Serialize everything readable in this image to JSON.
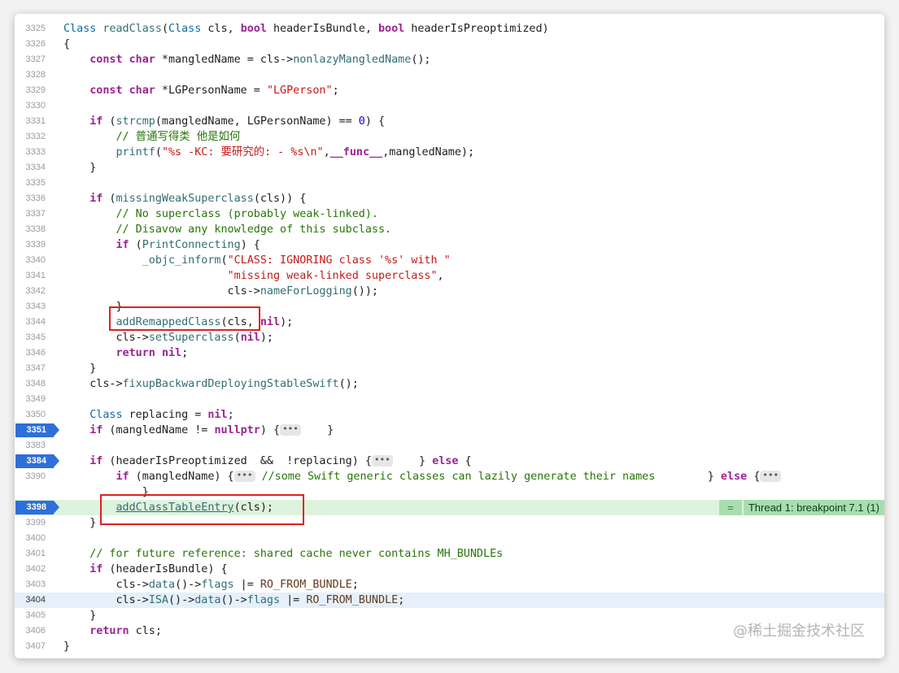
{
  "editor": {
    "lines": [
      {
        "n": "3325",
        "t": [
          [
            "ty",
            "Class "
          ],
          [
            "fn",
            "readClass"
          ],
          [
            "plain",
            "("
          ],
          [
            "ty",
            "Class"
          ],
          [
            "plain",
            " cls, "
          ],
          [
            "kw",
            "bool"
          ],
          [
            "plain",
            " headerIsBundle, "
          ],
          [
            "kw",
            "bool"
          ],
          [
            "plain",
            " headerIsPreoptimized)"
          ]
        ]
      },
      {
        "n": "3326",
        "t": [
          [
            "plain",
            "{"
          ]
        ]
      },
      {
        "n": "3327",
        "t": [
          [
            "plain",
            "    "
          ],
          [
            "kw",
            "const"
          ],
          [
            "plain",
            " "
          ],
          [
            "kw",
            "char"
          ],
          [
            "plain",
            " *mangledName = cls->"
          ],
          [
            "fn",
            "nonlazyMangledName"
          ],
          [
            "plain",
            "();"
          ]
        ]
      },
      {
        "n": "3328",
        "t": []
      },
      {
        "n": "3329",
        "t": [
          [
            "plain",
            "    "
          ],
          [
            "kw",
            "const"
          ],
          [
            "plain",
            " "
          ],
          [
            "kw",
            "char"
          ],
          [
            "plain",
            " *LGPersonName = "
          ],
          [
            "str",
            "\"LGPerson\""
          ],
          [
            "plain",
            ";"
          ]
        ]
      },
      {
        "n": "3330",
        "t": []
      },
      {
        "n": "3331",
        "t": [
          [
            "plain",
            "    "
          ],
          [
            "kw",
            "if"
          ],
          [
            "plain",
            " ("
          ],
          [
            "fn",
            "strcmp"
          ],
          [
            "plain",
            "(mangledName, LGPersonName) == "
          ],
          [
            "num",
            "0"
          ],
          [
            "plain",
            ") {"
          ]
        ]
      },
      {
        "n": "3332",
        "t": [
          [
            "plain",
            "        "
          ],
          [
            "cm",
            "// 普通写得类 他是如何"
          ]
        ]
      },
      {
        "n": "3333",
        "t": [
          [
            "plain",
            "        "
          ],
          [
            "fn",
            "printf"
          ],
          [
            "plain",
            "("
          ],
          [
            "str",
            "\"%s -KC: 要研究的: - %s\\n\""
          ],
          [
            "plain",
            ","
          ],
          [
            "kw",
            "__func__"
          ],
          [
            "plain",
            ",mangledName);"
          ]
        ]
      },
      {
        "n": "3334",
        "t": [
          [
            "plain",
            "    }"
          ]
        ]
      },
      {
        "n": "3335",
        "t": []
      },
      {
        "n": "3336",
        "t": [
          [
            "plain",
            "    "
          ],
          [
            "kw",
            "if"
          ],
          [
            "plain",
            " ("
          ],
          [
            "fn",
            "missingWeakSuperclass"
          ],
          [
            "plain",
            "(cls)) {"
          ]
        ]
      },
      {
        "n": "3337",
        "t": [
          [
            "plain",
            "        "
          ],
          [
            "cm",
            "// No superclass (probably weak-linked)."
          ]
        ]
      },
      {
        "n": "3338",
        "t": [
          [
            "plain",
            "        "
          ],
          [
            "cm",
            "// Disavow any knowledge of this subclass."
          ]
        ]
      },
      {
        "n": "3339",
        "t": [
          [
            "plain",
            "        "
          ],
          [
            "kw",
            "if"
          ],
          [
            "plain",
            " ("
          ],
          [
            "fn",
            "PrintConnecting"
          ],
          [
            "plain",
            ") {"
          ]
        ]
      },
      {
        "n": "3340",
        "t": [
          [
            "plain",
            "            "
          ],
          [
            "fn",
            "_objc_inform"
          ],
          [
            "plain",
            "("
          ],
          [
            "str",
            "\"CLASS: IGNORING class '%s' with \""
          ]
        ]
      },
      {
        "n": "3341",
        "t": [
          [
            "plain",
            "                         "
          ],
          [
            "str",
            "\"missing weak-linked superclass\""
          ],
          [
            "plain",
            ","
          ]
        ]
      },
      {
        "n": "3342",
        "t": [
          [
            "plain",
            "                         cls->"
          ],
          [
            "fn",
            "nameForLogging"
          ],
          [
            "plain",
            "());"
          ]
        ]
      },
      {
        "n": "3343",
        "t": [
          [
            "plain",
            "        }"
          ]
        ]
      },
      {
        "n": "3344",
        "t": [
          [
            "plain",
            "        "
          ],
          [
            "fn",
            "addRemappedClass"
          ],
          [
            "plain",
            "(cls, "
          ],
          [
            "kw",
            "nil"
          ],
          [
            "plain",
            ");"
          ]
        ]
      },
      {
        "n": "3345",
        "t": [
          [
            "plain",
            "        cls->"
          ],
          [
            "fn",
            "setSuperclass"
          ],
          [
            "plain",
            "("
          ],
          [
            "kw",
            "nil"
          ],
          [
            "plain",
            ");"
          ]
        ]
      },
      {
        "n": "3346",
        "t": [
          [
            "plain",
            "        "
          ],
          [
            "kw",
            "return"
          ],
          [
            "plain",
            " "
          ],
          [
            "kw",
            "nil"
          ],
          [
            "plain",
            ";"
          ]
        ]
      },
      {
        "n": "3347",
        "t": [
          [
            "plain",
            "    }"
          ]
        ]
      },
      {
        "n": "3348",
        "t": [
          [
            "plain",
            "    cls->"
          ],
          [
            "fn",
            "fixupBackwardDeployingStableSwift"
          ],
          [
            "plain",
            "();"
          ]
        ]
      },
      {
        "n": "3349",
        "t": []
      },
      {
        "n": "3350",
        "t": [
          [
            "plain",
            "    "
          ],
          [
            "ty",
            "Class"
          ],
          [
            "plain",
            " replacing = "
          ],
          [
            "kw",
            "nil"
          ],
          [
            "plain",
            ";"
          ]
        ]
      },
      {
        "n": "3351",
        "bp": true,
        "t": [
          [
            "plain",
            "    "
          ],
          [
            "kw",
            "if"
          ],
          [
            "plain",
            " (mangledName != "
          ],
          [
            "kw",
            "nullptr"
          ],
          [
            "plain",
            ") {"
          ],
          [
            "ell",
            "•••"
          ],
          [
            "plain",
            "    }"
          ]
        ]
      },
      {
        "n": "3383",
        "t": []
      },
      {
        "n": "3384",
        "bp": true,
        "t": [
          [
            "plain",
            "    "
          ],
          [
            "kw",
            "if"
          ],
          [
            "plain",
            " (headerIsPreoptimized  &&  !replacing) {"
          ],
          [
            "ell",
            "•••"
          ],
          [
            "plain",
            "    } "
          ],
          [
            "kw",
            "else"
          ],
          [
            "plain",
            " {"
          ]
        ]
      },
      {
        "n": "3390",
        "t": [
          [
            "plain",
            "        "
          ],
          [
            "kw",
            "if"
          ],
          [
            "plain",
            " (mangledName) {"
          ],
          [
            "ell",
            "•••"
          ],
          [
            "plain",
            " "
          ],
          [
            "cm",
            "//some Swift generic classes can lazily generate their names"
          ],
          [
            "plain",
            "        } "
          ],
          [
            "kw",
            "else"
          ],
          [
            "plain",
            " {"
          ],
          [
            "ell",
            "•••"
          ]
        ]
      },
      {
        "n": "",
        "t": [
          [
            "plain",
            "            }"
          ]
        ]
      },
      {
        "n": "3398",
        "bp": true,
        "hl": "green",
        "thread": true,
        "t": [
          [
            "plain",
            "        "
          ],
          [
            "fnul",
            "addClassTableEntry"
          ],
          [
            "plain",
            "(cls);"
          ]
        ]
      },
      {
        "n": "3399",
        "t": [
          [
            "plain",
            "    }"
          ]
        ]
      },
      {
        "n": "3400",
        "t": []
      },
      {
        "n": "3401",
        "t": [
          [
            "plain",
            "    "
          ],
          [
            "cm",
            "// for future reference: shared cache never contains MH_BUNDLEs"
          ]
        ]
      },
      {
        "n": "3402",
        "t": [
          [
            "plain",
            "    "
          ],
          [
            "kw",
            "if"
          ],
          [
            "plain",
            " (headerIsBundle) {"
          ]
        ]
      },
      {
        "n": "3403",
        "t": [
          [
            "plain",
            "        cls->"
          ],
          [
            "fn",
            "data"
          ],
          [
            "plain",
            "()->"
          ],
          [
            "fn",
            "flags"
          ],
          [
            "plain",
            " |= "
          ],
          [
            "mac",
            "RO_FROM_BUNDLE"
          ],
          [
            "plain",
            ";"
          ]
        ]
      },
      {
        "n": "3404",
        "hl": "blue",
        "t": [
          [
            "plain",
            "        cls->"
          ],
          [
            "fn",
            "ISA"
          ],
          [
            "plain",
            "()->"
          ],
          [
            "fn",
            "data"
          ],
          [
            "plain",
            "()->"
          ],
          [
            "fn",
            "flags"
          ],
          [
            "plain",
            " |= "
          ],
          [
            "mac",
            "RO_FROM_BUNDLE"
          ],
          [
            "plain",
            ";"
          ]
        ]
      },
      {
        "n": "3405",
        "t": [
          [
            "plain",
            "    }"
          ]
        ]
      },
      {
        "n": "3406",
        "t": [
          [
            "plain",
            "    "
          ],
          [
            "kw",
            "return"
          ],
          [
            "plain",
            " cls;"
          ]
        ]
      },
      {
        "n": "3407",
        "t": [
          [
            "plain",
            "}"
          ]
        ]
      }
    ],
    "thread_badge": {
      "eq": "=",
      "label": "Thread 1: breakpoint 7.1 (1)"
    }
  },
  "watermark": "@稀土掘金技术社区",
  "colors": {
    "breakpoint": "#2f6fd8",
    "highlight_line": "#ddf3dd",
    "annotation_box": "#e02020"
  }
}
